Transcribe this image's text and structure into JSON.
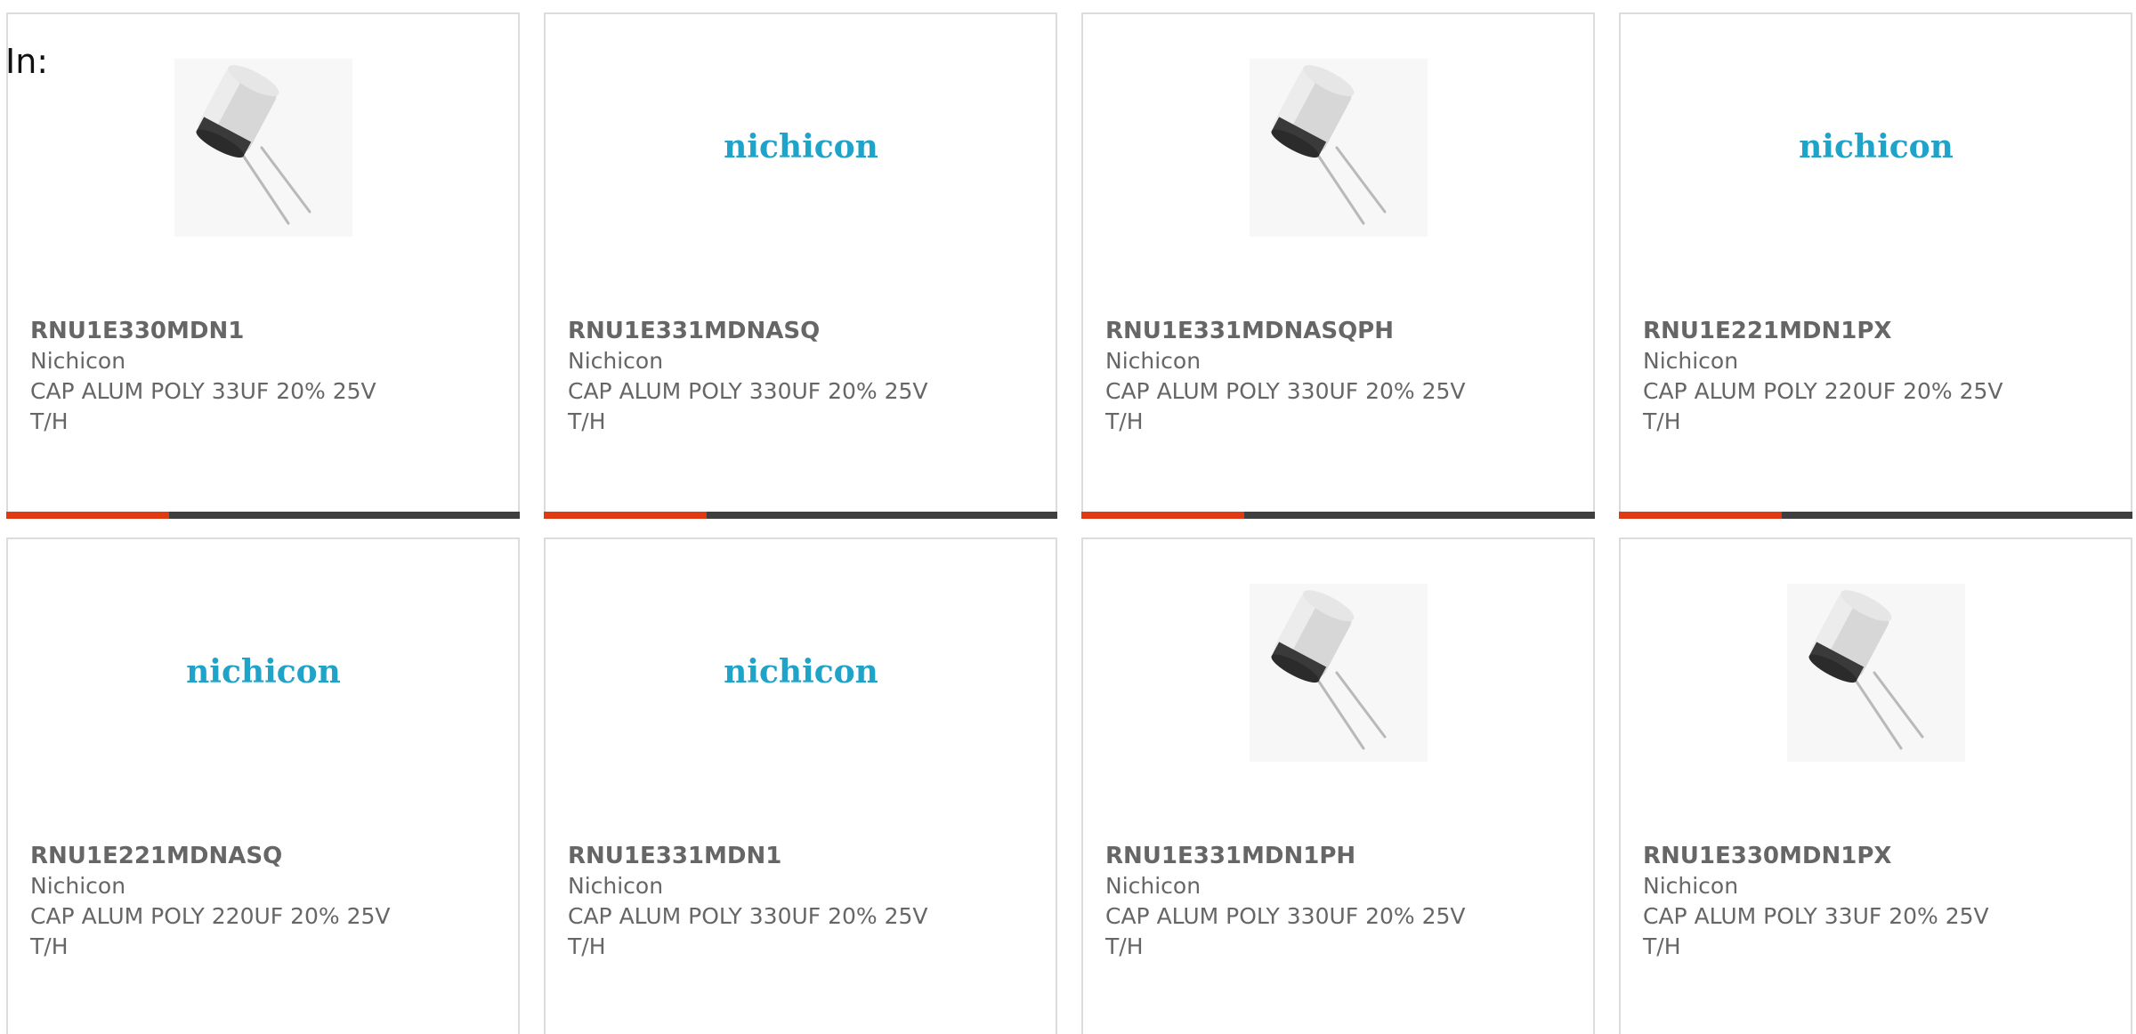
{
  "header": {
    "in_label": "In:"
  },
  "brand": {
    "logo_text": "nichicon",
    "logo_color": "#1fa3c9",
    "accent_color": "#e03a12",
    "bar_color": "#3f3f3f"
  },
  "products": [
    {
      "part_number": "RNU1E330MDN1",
      "manufacturer": "Nichicon",
      "description": "CAP ALUM POLY 33UF 20% 25V T/H",
      "image": "capacitor-photo"
    },
    {
      "part_number": "RNU1E331MDNASQ",
      "manufacturer": "Nichicon",
      "description": "CAP ALUM POLY 330UF 20% 25V T/H",
      "image": "nichicon-logo"
    },
    {
      "part_number": "RNU1E331MDNASQPH",
      "manufacturer": "Nichicon",
      "description": "CAP ALUM POLY 330UF 20% 25V T/H",
      "image": "capacitor-photo"
    },
    {
      "part_number": "RNU1E221MDN1PX",
      "manufacturer": "Nichicon",
      "description": "CAP ALUM POLY 220UF 20% 25V T/H",
      "image": "nichicon-logo"
    },
    {
      "part_number": "RNU1E221MDNASQ",
      "manufacturer": "Nichicon",
      "description": "CAP ALUM POLY 220UF 20% 25V T/H",
      "image": "nichicon-logo"
    },
    {
      "part_number": "RNU1E331MDN1",
      "manufacturer": "Nichicon",
      "description": "CAP ALUM POLY 330UF 20% 25V T/H",
      "image": "nichicon-logo"
    },
    {
      "part_number": "RNU1E331MDN1PH",
      "manufacturer": "Nichicon",
      "description": "CAP ALUM POLY 330UF 20% 25V T/H",
      "image": "capacitor-photo"
    },
    {
      "part_number": "RNU1E330MDN1PX",
      "manufacturer": "Nichicon",
      "description": "CAP ALUM POLY 33UF 20% 25V T/H",
      "image": "capacitor-photo"
    }
  ]
}
